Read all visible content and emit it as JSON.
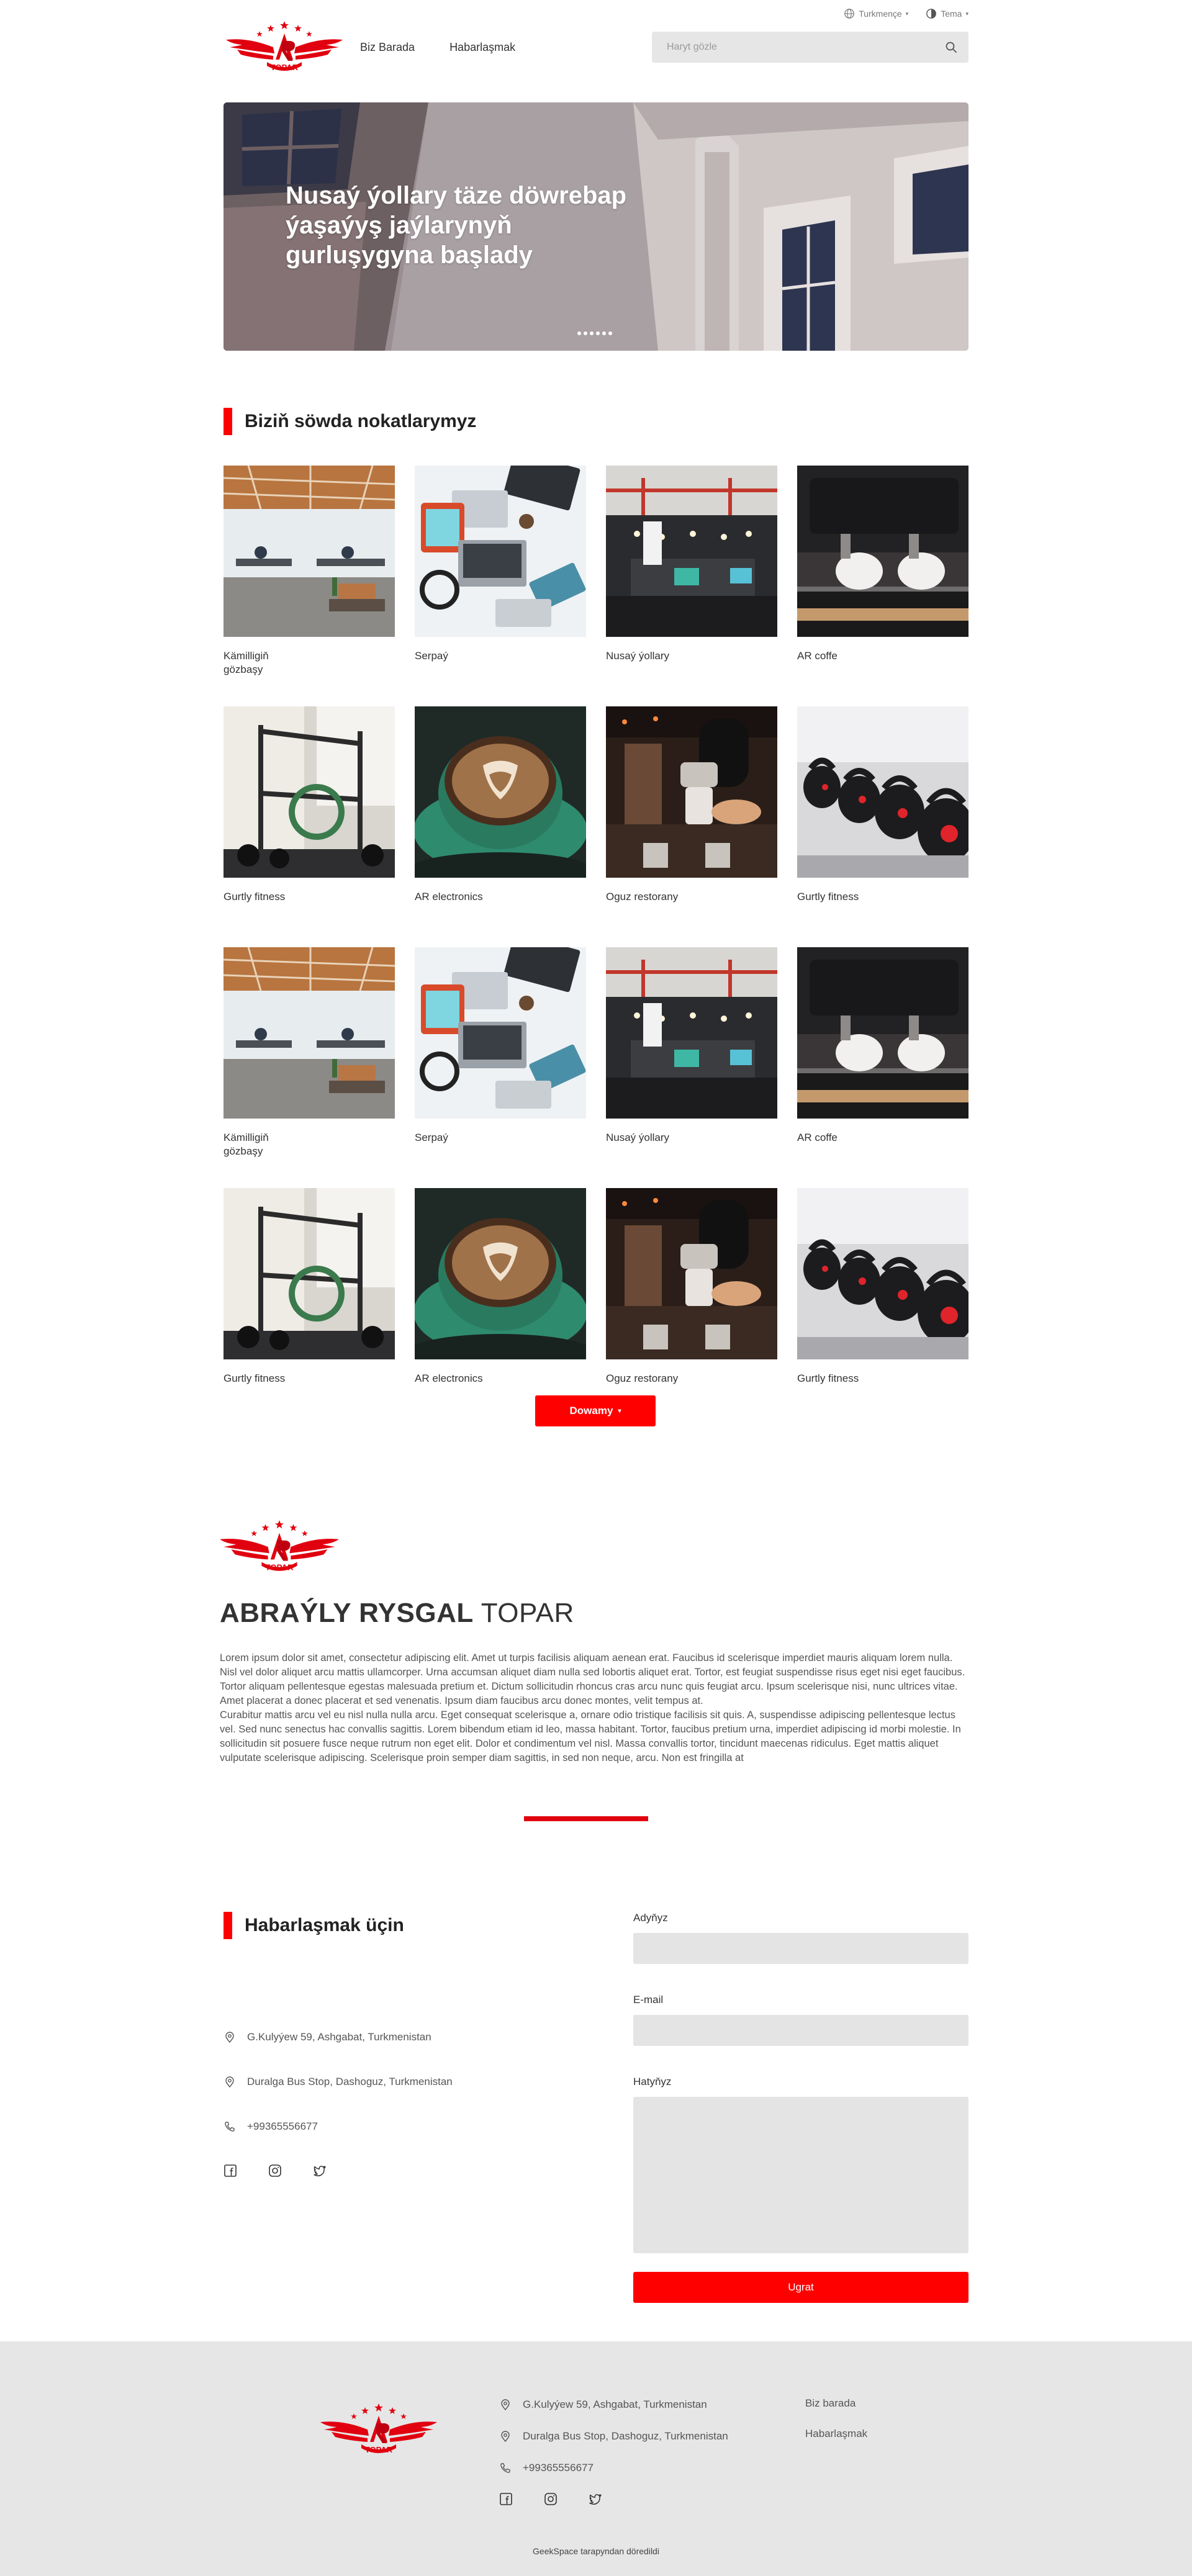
{
  "topbar": {
    "language": "Turkmençe",
    "theme": "Tema"
  },
  "nav": {
    "about": "Biz Barada",
    "contact": "Habarlaşmak"
  },
  "search": {
    "placeholder": "Haryt gözle"
  },
  "hero": {
    "title": "Nusaý ýollary täze döwrebap ýaşaýyş jaýlarynyň gurluşygyna başlady",
    "slides_count": 6
  },
  "shops": {
    "title": "Biziň söwda nokatlarymyz",
    "items": [
      {
        "label": "Kämilligiň gözbaşy",
        "image": "office-photo"
      },
      {
        "label": "Serpaý",
        "image": "laptops-desk-photo"
      },
      {
        "label": "Nusaý ýollary",
        "image": "dark-office-photo"
      },
      {
        "label": "AR coffe",
        "image": "espresso-machine-photo"
      },
      {
        "label": "Gurtly fitness",
        "image": "gym-machine-photo"
      },
      {
        "label": "AR electronics",
        "image": "latte-cup-photo"
      },
      {
        "label": "Oguz restorany",
        "image": "barista-pour-photo"
      },
      {
        "label": "Gurtly fitness",
        "image": "kettlebells-photo"
      },
      {
        "label": "Kämilligiň gözbaşy",
        "image": "office-photo"
      },
      {
        "label": "Serpaý",
        "image": "laptops-desk-photo"
      },
      {
        "label": "Nusaý ýollary",
        "image": "dark-office-photo"
      },
      {
        "label": "AR coffe",
        "image": "espresso-machine-photo"
      },
      {
        "label": "Gurtly fitness",
        "image": "gym-machine-photo"
      },
      {
        "label": "AR electronics",
        "image": "latte-cup-photo"
      },
      {
        "label": "Oguz restorany",
        "image": "barista-pour-photo"
      },
      {
        "label": "Gurtly fitness",
        "image": "kettlebells-photo"
      }
    ],
    "more_label": "Dowamy"
  },
  "about": {
    "title_bold": "ABRAÝLY RYSGAL",
    "title_light": "TOPAR",
    "paragraph1": "Lorem ipsum dolor sit amet, consectetur adipiscing elit. Amet ut turpis facilisis aliquam aenean erat. Faucibus id scelerisque imperdiet mauris aliquam lorem nulla. Nisl vel dolor aliquet arcu mattis ullamcorper. Urna accumsan aliquet diam nulla sed lobortis aliquet erat. Tortor, est feugiat suspendisse risus eget nisi eget faucibus. Tortor aliquam pellentesque egestas malesuada pretium et. Dictum sollicitudin rhoncus cras arcu nunc quis feugiat arcu. Ipsum scelerisque nisi, nunc ultrices vitae. Amet placerat a donec placerat et sed venenatis. Ipsum diam faucibus arcu donec montes, velit tempus at.",
    "paragraph2": "Curabitur mattis arcu vel eu nisl nulla nulla arcu. Eget consequat scelerisque a, ornare odio tristique facilisis sit quis. A, suspendisse adipiscing pellentesque lectus vel. Sed nunc senectus hac convallis sagittis. Lorem bibendum etiam id leo, massa habitant. Tortor, faucibus pretium urna, imperdiet adipiscing id morbi molestie. In sollicitudin sit posuere fusce neque rutrum non eget elit. Dolor et condimentum vel nisl. Massa convallis tortor, tincidunt maecenas ridiculus. Eget mattis aliquet vulputate scelerisque adipiscing. Scelerisque proin semper diam sagittis, in sed non neque, arcu. Non est fringilla at"
  },
  "logo": {
    "text": "TOPAR"
  },
  "contact": {
    "title": "Habarlaşmak üçin",
    "address1": "G.Kulyýew 59, Ashgabat, Turkmenistan",
    "address2": "Duralga Bus Stop, Dashoguz, Turkmenistan",
    "phone": "+99365556677",
    "form": {
      "name_label": "Adyňyz",
      "email_label": "E-mail",
      "message_label": "Hatyňyz",
      "submit": "Ugrat"
    }
  },
  "footer": {
    "address1": "G.Kulyýew 59, Ashgabat, Turkmenistan",
    "address2": "Duralga Bus Stop, Dashoguz, Turkmenistan",
    "phone": "+99365556677",
    "links": [
      "Biz barada",
      "Habarlaşmak"
    ],
    "credit": "GeekSpace tarapyndan döredildi"
  },
  "colors": {
    "accent": "#ff0000",
    "footer_bg": "#e6e6e6",
    "input_bg": "#e4e4e4"
  }
}
